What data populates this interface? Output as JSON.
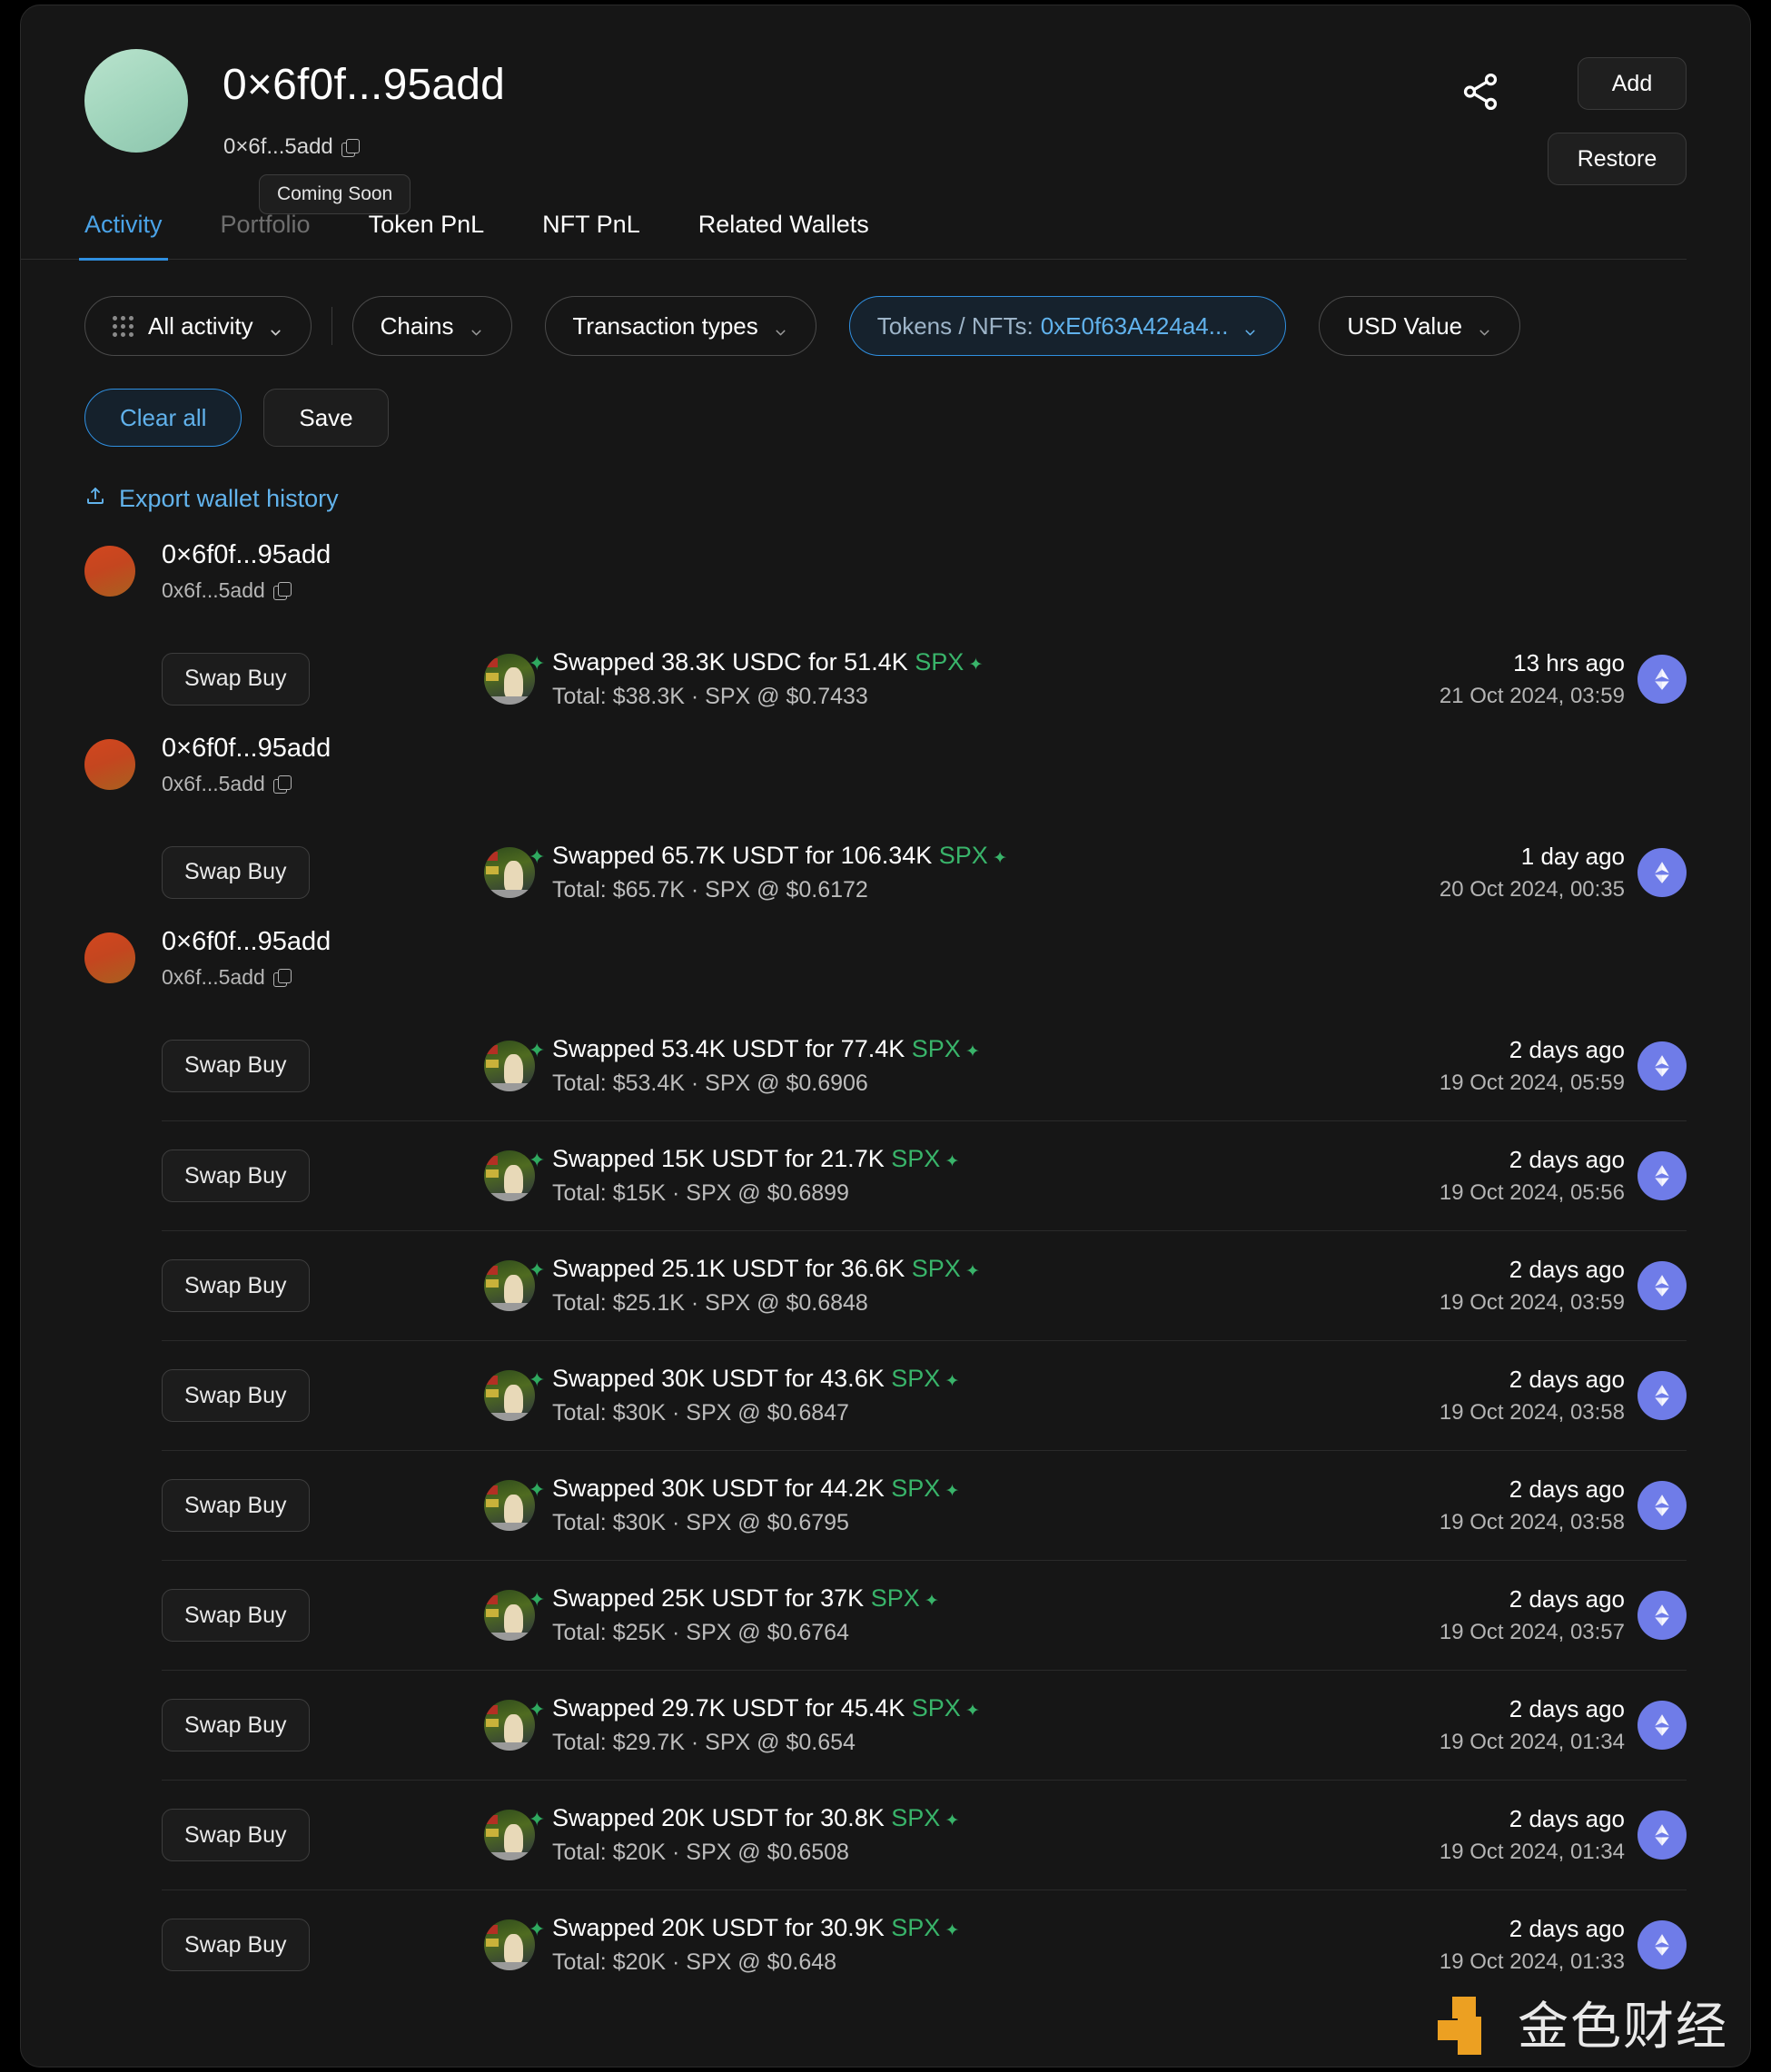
{
  "header": {
    "title": "0×6f0f...95add",
    "address_short": "0×6f...5add",
    "copy_icon": "copy-icon",
    "share_icon": "share-icon",
    "add_label": "Add",
    "restore_label": "Restore"
  },
  "tabs": [
    {
      "label": "Activity",
      "state": "active"
    },
    {
      "label": "Portfolio",
      "state": "disabled",
      "tooltip": "Coming Soon"
    },
    {
      "label": "Token PnL",
      "state": "normal"
    },
    {
      "label": "NFT PnL",
      "state": "normal"
    },
    {
      "label": "Related Wallets",
      "state": "normal"
    }
  ],
  "filters": {
    "all_activity": "All activity",
    "chains": "Chains",
    "transaction_types": "Transaction types",
    "tokens_nfts_label": "Tokens / NFTs:",
    "tokens_nfts_value": "0xE0f63A424a4...",
    "usd_value": "USD Value",
    "clear_all": "Clear all",
    "save": "Save",
    "export": "Export wallet history",
    "export_icon": "upload-icon",
    "grid_icon": "grid-icon",
    "chevron_icon": "chevron-down-icon"
  },
  "colors": {
    "accent_blue": "#2f8fe0",
    "link_blue": "#61b2ec",
    "token_green": "#39b46a",
    "chain_purple": "#6f7ce8"
  },
  "groups": [
    {
      "title": "0×6f0f...95add",
      "address_short": "0x6f...5add",
      "rows": [
        {
          "action": "Swap Buy",
          "desc_prefix": "Swapped 38.3K USDC for 51.4K ",
          "symbol": "SPX",
          "detail": "Total: $38.3K · SPX @ $0.7433",
          "ago": "13 hrs ago",
          "date": "21 Oct 2024, 03:59",
          "chain": "ethereum"
        }
      ]
    },
    {
      "title": "0×6f0f...95add",
      "address_short": "0x6f...5add",
      "rows": [
        {
          "action": "Swap Buy",
          "desc_prefix": "Swapped 65.7K USDT for 106.34K ",
          "symbol": "SPX",
          "detail": "Total: $65.7K · SPX @ $0.6172",
          "ago": "1 day ago",
          "date": "20 Oct 2024, 00:35",
          "chain": "ethereum"
        }
      ]
    },
    {
      "title": "0×6f0f...95add",
      "address_short": "0x6f...5add",
      "rows": [
        {
          "action": "Swap Buy",
          "desc_prefix": "Swapped 53.4K USDT for 77.4K ",
          "symbol": "SPX",
          "detail": "Total: $53.4K · SPX @ $0.6906",
          "ago": "2 days ago",
          "date": "19 Oct 2024, 05:59",
          "chain": "ethereum"
        },
        {
          "action": "Swap Buy",
          "desc_prefix": "Swapped 15K USDT for 21.7K ",
          "symbol": "SPX",
          "detail": "Total: $15K · SPX @ $0.6899",
          "ago": "2 days ago",
          "date": "19 Oct 2024, 05:56",
          "chain": "ethereum"
        },
        {
          "action": "Swap Buy",
          "desc_prefix": "Swapped 25.1K USDT for 36.6K ",
          "symbol": "SPX",
          "detail": "Total: $25.1K · SPX @ $0.6848",
          "ago": "2 days ago",
          "date": "19 Oct 2024, 03:59",
          "chain": "ethereum"
        },
        {
          "action": "Swap Buy",
          "desc_prefix": "Swapped 30K USDT for 43.6K ",
          "symbol": "SPX",
          "detail": "Total: $30K · SPX @ $0.6847",
          "ago": "2 days ago",
          "date": "19 Oct 2024, 03:58",
          "chain": "ethereum"
        },
        {
          "action": "Swap Buy",
          "desc_prefix": "Swapped 30K USDT for 44.2K ",
          "symbol": "SPX",
          "detail": "Total: $30K · SPX @ $0.6795",
          "ago": "2 days ago",
          "date": "19 Oct 2024, 03:58",
          "chain": "ethereum"
        },
        {
          "action": "Swap Buy",
          "desc_prefix": "Swapped 25K USDT for 37K ",
          "symbol": "SPX",
          "detail": "Total: $25K · SPX @ $0.6764",
          "ago": "2 days ago",
          "date": "19 Oct 2024, 03:57",
          "chain": "ethereum"
        },
        {
          "action": "Swap Buy",
          "desc_prefix": "Swapped 29.7K USDT for 45.4K ",
          "symbol": "SPX",
          "detail": "Total: $29.7K · SPX @ $0.654",
          "ago": "2 days ago",
          "date": "19 Oct 2024, 01:34",
          "chain": "ethereum"
        },
        {
          "action": "Swap Buy",
          "desc_prefix": "Swapped 20K USDT for 30.8K ",
          "symbol": "SPX",
          "detail": "Total: $20K · SPX @ $0.6508",
          "ago": "2 days ago",
          "date": "19 Oct 2024, 01:34",
          "chain": "ethereum"
        },
        {
          "action": "Swap Buy",
          "desc_prefix": "Swapped 20K USDT for 30.9K ",
          "symbol": "SPX",
          "detail": "Total: $20K · SPX @ $0.648",
          "ago": "2 days ago",
          "date": "19 Oct 2024, 01:33",
          "chain": "ethereum"
        }
      ]
    }
  ],
  "watermark": {
    "text": "金色财经"
  }
}
